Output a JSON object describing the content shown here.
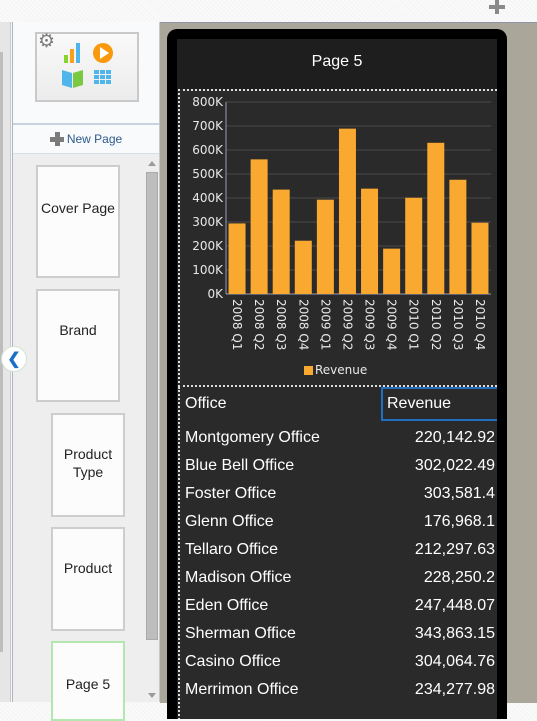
{
  "toolbar": {
    "add_icon": "plus-icon"
  },
  "sidebar": {
    "app_tile": {
      "settings_icon": "gear-icon",
      "icons": [
        "bar-chart-icon",
        "play-icon",
        "book-icon",
        "grid-icon"
      ]
    },
    "new_page_label": "New Page",
    "pages": [
      {
        "label": "Cover Page",
        "active": false
      },
      {
        "label": "Brand",
        "active": false
      },
      {
        "label": "Product Type",
        "active": false
      },
      {
        "label": "Product",
        "active": false
      },
      {
        "label": "Page 5",
        "active": true
      }
    ],
    "collapse_icon": "chevron-left-icon"
  },
  "page": {
    "title": "Page 5",
    "table": {
      "columns": [
        "Office",
        "Revenue"
      ],
      "rows": [
        [
          "Montgomery Office",
          "220,142.92"
        ],
        [
          "Blue Bell Office",
          "302,022.49"
        ],
        [
          "Foster Office",
          "303,581.4"
        ],
        [
          "Glenn Office",
          "176,968.1"
        ],
        [
          "Tellaro Office",
          "212,297.63"
        ],
        [
          "Madison Office",
          "228,250.2"
        ],
        [
          "Eden Office",
          "247,448.07"
        ],
        [
          "Sherman Office",
          "343,863.15"
        ],
        [
          "Casino Office",
          "304,064.76"
        ],
        [
          "Merrimon Office",
          "234,277.98"
        ]
      ]
    }
  },
  "colors": {
    "bar": "#f9a92f",
    "accent": "#1f70c1",
    "active_page_border": "#b2e8b0"
  },
  "chart_data": {
    "type": "bar",
    "title": "",
    "xlabel": "",
    "ylabel": "",
    "categories": [
      "2008 Q1",
      "2008 Q2",
      "2008 Q3",
      "2008 Q4",
      "2009 Q1",
      "2009 Q2",
      "2009 Q3",
      "2009 Q4",
      "2010 Q1",
      "2010 Q2",
      "2010 Q3",
      "2010 Q4"
    ],
    "series": [
      {
        "name": "Revenue",
        "values": [
          294000,
          561000,
          435000,
          222000,
          393000,
          689000,
          439000,
          189000,
          401000,
          630000,
          476000,
          297000
        ]
      }
    ],
    "ylim": [
      0,
      800000
    ],
    "yticks": [
      0,
      100000,
      200000,
      300000,
      400000,
      500000,
      600000,
      700000,
      800000
    ],
    "ytick_labels": [
      "0K",
      "100K",
      "200K",
      "300K",
      "400K",
      "500K",
      "600K",
      "700K",
      "800K"
    ],
    "grid": true,
    "legend": "bottom"
  }
}
